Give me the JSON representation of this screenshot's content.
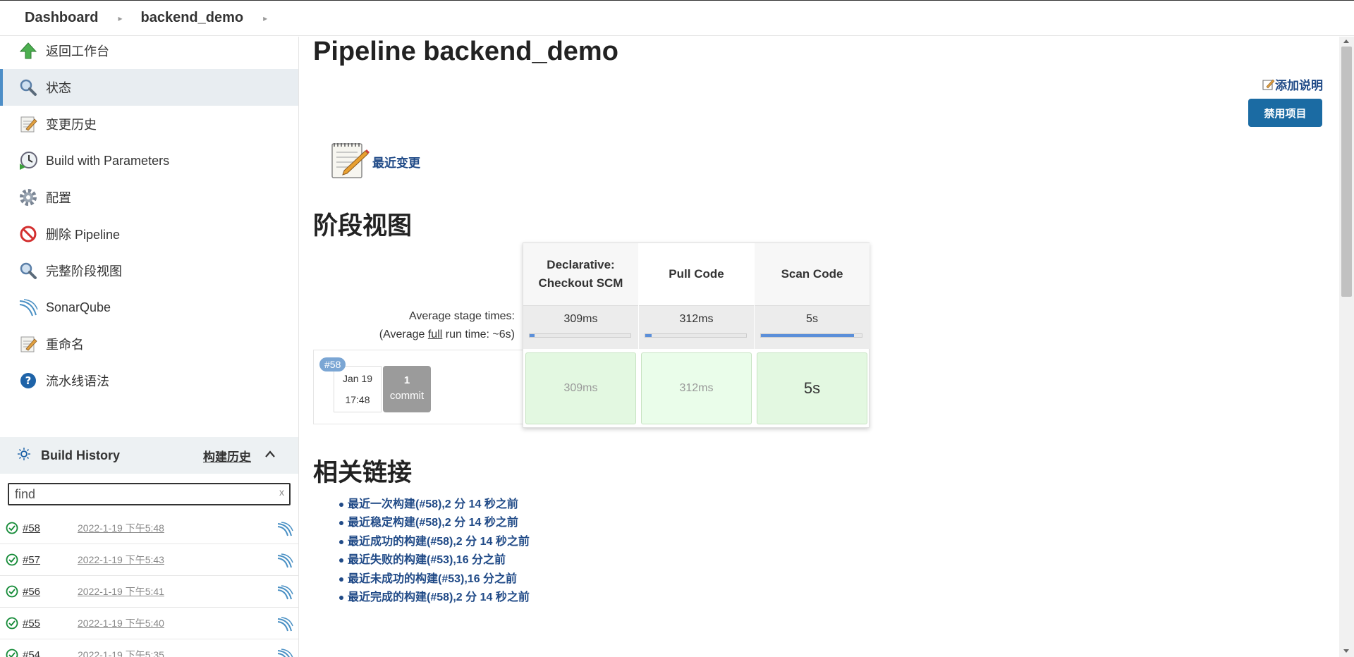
{
  "breadcrumb": {
    "dashboard": "Dashboard",
    "project": "backend_demo"
  },
  "sidebar": {
    "items": [
      {
        "label": "返回工作台",
        "icon": "up-arrow-icon"
      },
      {
        "label": "状态",
        "icon": "search-icon"
      },
      {
        "label": "变更历史",
        "icon": "notepad-icon"
      },
      {
        "label": "Build with Parameters",
        "icon": "clock-play-icon"
      },
      {
        "label": "配置",
        "icon": "gear-icon"
      },
      {
        "label": "删除 Pipeline",
        "icon": "no-entry-icon"
      },
      {
        "label": "完整阶段视图",
        "icon": "search-icon"
      },
      {
        "label": "SonarQube",
        "icon": "sonarqube-icon"
      },
      {
        "label": "重命名",
        "icon": "notepad-icon"
      },
      {
        "label": "流水线语法",
        "icon": "help-icon"
      }
    ]
  },
  "build_history": {
    "title": "Build History",
    "trend_link": "构建历史",
    "search_placeholder": "find",
    "search_clear": "x",
    "rows": [
      {
        "number": "#58",
        "time": "2022-1-19 下午5:48"
      },
      {
        "number": "#57",
        "time": "2022-1-19 下午5:43"
      },
      {
        "number": "#56",
        "time": "2022-1-19 下午5:41"
      },
      {
        "number": "#55",
        "time": "2022-1-19 下午5:40"
      },
      {
        "number": "#54",
        "time": "2022-1-19 下午5:35"
      }
    ]
  },
  "main": {
    "title": "Pipeline backend_demo",
    "add_description": "添加说明",
    "disable_button": "禁用项目",
    "recent_changes": "最近变更",
    "stage_view_heading": "阶段视图",
    "related_links_heading": "相关链接"
  },
  "stage_view": {
    "avg_stage_label": "Average stage times:",
    "avg_full_prefix": "(Average ",
    "avg_full_word": "full",
    "avg_full_suffix": " run time: ~6s)",
    "run": {
      "badge": "#58",
      "date": "Jan 19",
      "time": "17:48",
      "commit_count": "1",
      "commit_label": "commit"
    },
    "stages": [
      {
        "name_line1": "Declarative:",
        "name_line2": "Checkout SCM",
        "avg": "309ms",
        "avg_fraction": 0.05,
        "cell": "309ms"
      },
      {
        "name_line1": "Pull Code",
        "name_line2": "",
        "avg": "312ms",
        "avg_fraction": 0.06,
        "cell": "312ms"
      },
      {
        "name_line1": "Scan Code",
        "name_line2": "",
        "avg": "5s",
        "avg_fraction": 0.92,
        "cell": "5s"
      }
    ]
  },
  "related_links": [
    "最近一次构建(#58),2 分 14 秒之前",
    "最近稳定构建(#58),2 分 14 秒之前",
    "最近成功的构建(#58),2 分 14 秒之前",
    "最近失败的构建(#53),16 分之前",
    "最近未成功的构建(#53),16 分之前",
    "最近完成的构建(#58),2 分 14 秒之前"
  ],
  "colors": {
    "link": "#204a87",
    "accent": "#1b6ba3",
    "success": "#138a36"
  }
}
